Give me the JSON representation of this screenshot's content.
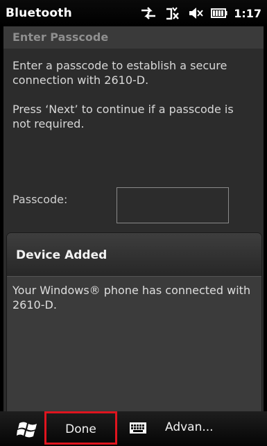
{
  "statusbar": {
    "title": "Bluetooth",
    "clock": "1:17",
    "icons": [
      "connectivity-icon",
      "signal-off-icon",
      "volume-muted-icon",
      "battery-icon"
    ]
  },
  "page": {
    "heading": "Enter Passcode",
    "paragraph1": "Enter a passcode to establish a secure connection with 2610-D.",
    "paragraph2": "Press ‘Next’ to continue if a passcode is not required.",
    "passcode_label": "Passcode:",
    "passcode_value": ""
  },
  "dialog": {
    "title": "Device Added",
    "body": "Your Windows® phone has connected with 2610-D."
  },
  "taskbar": {
    "left_softkey": "Done",
    "right_softkey": "Advan...",
    "highlight_color": "#e0141e"
  }
}
